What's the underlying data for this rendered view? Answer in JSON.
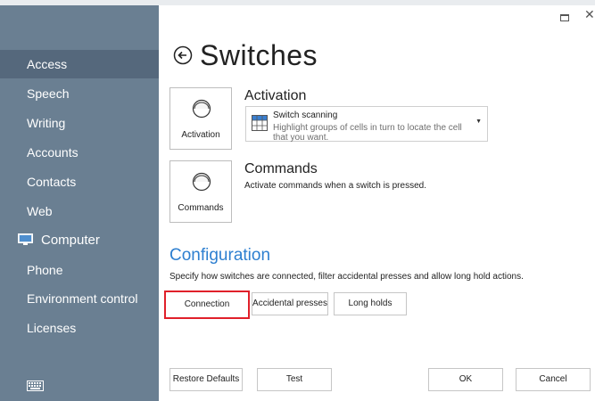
{
  "sidebar": {
    "items": [
      {
        "label": "Access",
        "active": true
      },
      {
        "label": "Speech"
      },
      {
        "label": "Writing"
      },
      {
        "label": "Accounts"
      },
      {
        "label": "Contacts"
      },
      {
        "label": "Web"
      },
      {
        "label": "Computer",
        "icon": "computer-icon"
      },
      {
        "label": "Phone"
      },
      {
        "label": "Environment control"
      },
      {
        "label": "Licenses"
      }
    ],
    "keyboard_icon": "keyboard-icon"
  },
  "window": {
    "restore_icon": "restore-icon",
    "close_icon": "close-icon"
  },
  "page": {
    "title": "Switches",
    "back_icon": "back-arrow-icon"
  },
  "activation": {
    "tile_label": "Activation",
    "heading": "Activation",
    "dropdown": {
      "title": "Switch scanning",
      "description": "Highlight groups of cells in turn to locate the cell that you want."
    }
  },
  "commands": {
    "tile_label": "Commands",
    "heading": "Commands",
    "description": "Activate commands when a switch is pressed."
  },
  "configuration": {
    "heading": "Configuration",
    "description": "Specify how switches are connected, filter accidental presses and allow long hold actions.",
    "buttons": [
      "Connection",
      "Accidental presses",
      "Long holds"
    ]
  },
  "footer": {
    "restore_defaults": "Restore Defaults",
    "test": "Test",
    "ok": "OK",
    "cancel": "Cancel"
  },
  "colors": {
    "sidebar": "#6a7f92",
    "sidebar_active": "#55687c",
    "accent": "#2d7fd0",
    "highlight": "#e0202a"
  }
}
